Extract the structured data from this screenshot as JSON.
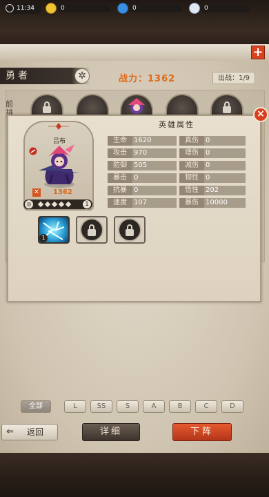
{
  "status": {
    "time": "11:34"
  },
  "resources": [
    {
      "name": "gold",
      "value": "0",
      "color": "#f1c232"
    },
    {
      "name": "gem",
      "value": "0",
      "color": "#3b8fe0"
    },
    {
      "name": "crystal",
      "value": "0",
      "color": "#dfe9f5"
    }
  ],
  "header": {
    "tab_label": "勇者",
    "power_label": "战力：1362",
    "deploy_label": "出战：1/9"
  },
  "formation": {
    "front_label": "前排"
  },
  "panel": {
    "hero_name": "吕布",
    "hero_power": "1362",
    "hero_level": "1",
    "attr_title": "英雄属性",
    "attrs_left": [
      {
        "key": "生命",
        "value": "1620"
      },
      {
        "key": "攻击",
        "value": "970"
      },
      {
        "key": "防御",
        "value": "505"
      },
      {
        "key": "暴击",
        "value": "0"
      },
      {
        "key": "抗暴",
        "value": "0"
      },
      {
        "key": "速度",
        "value": "107"
      }
    ],
    "attrs_right": [
      {
        "key": "真伤",
        "value": "0"
      },
      {
        "key": "增伤",
        "value": "0"
      },
      {
        "key": "减伤",
        "value": "0"
      },
      {
        "key": "韧性",
        "value": "0"
      },
      {
        "key": "悟性",
        "value": "202"
      },
      {
        "key": "暴伤",
        "value": "10000"
      }
    ],
    "skill_level": "1"
  },
  "filters": [
    "全部",
    "L",
    "SS",
    "S",
    "A",
    "B",
    "C",
    "D"
  ],
  "buttons": {
    "back": "返回",
    "detail": "详细",
    "down": "下阵"
  }
}
